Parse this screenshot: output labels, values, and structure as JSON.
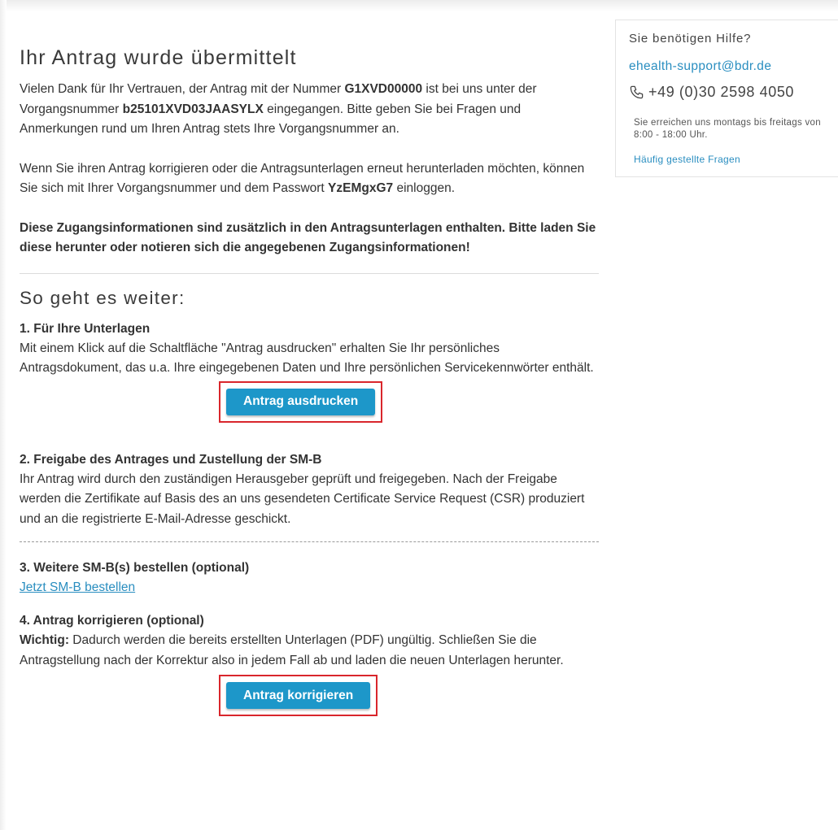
{
  "confirmation": {
    "title": "Ihr Antrag wurde übermittelt",
    "p1_a": "Vielen Dank für Ihr Vertrauen, der Antrag mit der Nummer ",
    "application_number": "G1XVD00000",
    "p1_b": " ist bei uns unter der Vorgangsnummer ",
    "process_number": "b25101XVD03JAASYLX",
    "p1_c": " eingegangen. Bitte geben Sie bei Fragen und Anmerkungen rund um Ihren Antrag stets Ihre Vorgangsnummer an.",
    "p2_a": "Wenn Sie ihren Antrag korrigieren oder die Antragsunterlagen erneut herunterladen möchten, können Sie sich mit Ihrer Vorgangsnummer und dem Passwort ",
    "password": "YzEMgxG7",
    "p2_b": " einloggen.",
    "p3": "Diese Zugangsinformationen sind zusätzlich in den Antragsunterlagen enthalten. Bitte laden Sie diese herunter oder notieren sich die angegebenen Zugangsinformationen!"
  },
  "next_steps": {
    "title": "So geht es weiter:",
    "step1": {
      "title": "1. Für Ihre Unterlagen",
      "text": "Mit einem Klick auf die Schaltfläche \"Antrag ausdrucken\" erhalten Sie Ihr persönliches Antragsdokument, das u.a. Ihre eingegebenen Daten und Ihre persönlichen Servicekennwörter enthält.",
      "button": "Antrag ausdrucken"
    },
    "step2": {
      "title": "2. Freigabe des Antrages und Zustellung der SM-B",
      "text": "Ihr Antrag wird durch den zuständigen Herausgeber geprüft und freigegeben. Nach der Freigabe werden die Zertifikate auf Basis des an uns gesendeten Certificate Service Request (CSR) produziert und an die registrierte E-Mail-Adresse geschickt."
    },
    "step3": {
      "title": "3. Weitere SM-B(s) bestellen (optional)",
      "link": "Jetzt SM-B bestellen"
    },
    "step4": {
      "title": "4. Antrag korrigieren (optional)",
      "important_label": "Wichtig:",
      "text": " Dadurch werden die bereits erstellten Unterlagen (PDF) ungültig. Schließen Sie die Antragstellung nach der Korrektur also in jedem Fall ab und laden die neuen Unterlagen herunter.",
      "button": "Antrag korrigieren"
    }
  },
  "help": {
    "title": "Sie benötigen Hilfe?",
    "email": "ehealth-support@bdr.de",
    "phone": "+49 (0)30 2598 4050",
    "phone_icon": "phone-icon",
    "hours": "Sie erreichen uns montags bis freitags von 8:00 - 18:00 Uhr.",
    "faq_link": "Häufig gestellte Fragen"
  },
  "colors": {
    "accent": "#1d97c9",
    "link": "#2a8ec0",
    "highlight_border": "#d9262c"
  }
}
